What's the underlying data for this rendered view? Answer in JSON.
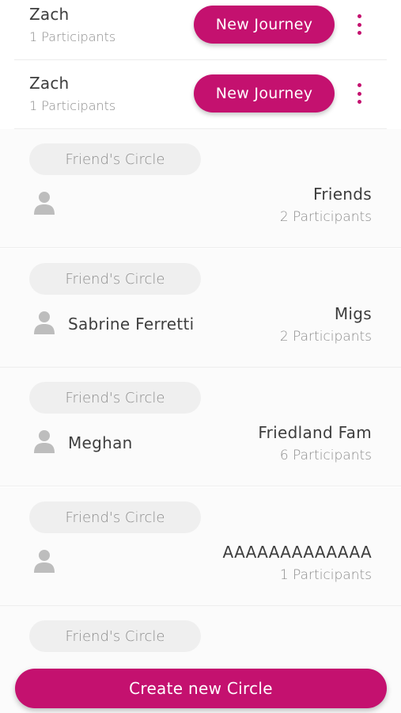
{
  "journeys": [
    {
      "name": "Zach",
      "participants": "1 Participants",
      "button_label": "New Journey",
      "menu_icon": "more-vertical-icon"
    },
    {
      "name": "Zach",
      "participants": "1 Participants",
      "button_label": "New Journey",
      "menu_icon": "more-vertical-icon"
    }
  ],
  "circles": [
    {
      "chip": "Friend's Circle",
      "member": "",
      "name": "Friends",
      "participants": "2 Participants",
      "icon": "user-icon"
    },
    {
      "chip": "Friend's Circle",
      "member": "Sabrine Ferretti",
      "name": "Migs",
      "participants": "2 Participants",
      "icon": "user-icon"
    },
    {
      "chip": "Friend's Circle",
      "member": "Meghan",
      "name": "Friedland Fam",
      "participants": "6 Participants",
      "icon": "user-icon"
    },
    {
      "chip": "Friend's Circle",
      "member": "",
      "name": "AAAAAAAAAAAAA",
      "participants": "1 Participants",
      "icon": "user-icon"
    },
    {
      "chip": "Friend's Circle",
      "member": "",
      "name": "",
      "participants": "",
      "icon": ""
    }
  ],
  "create_button": {
    "label": "Create new Circle"
  },
  "colors": {
    "accent": "#c4116f",
    "chip_bg": "#efefef",
    "icon_grey": "#bdbdbd"
  }
}
